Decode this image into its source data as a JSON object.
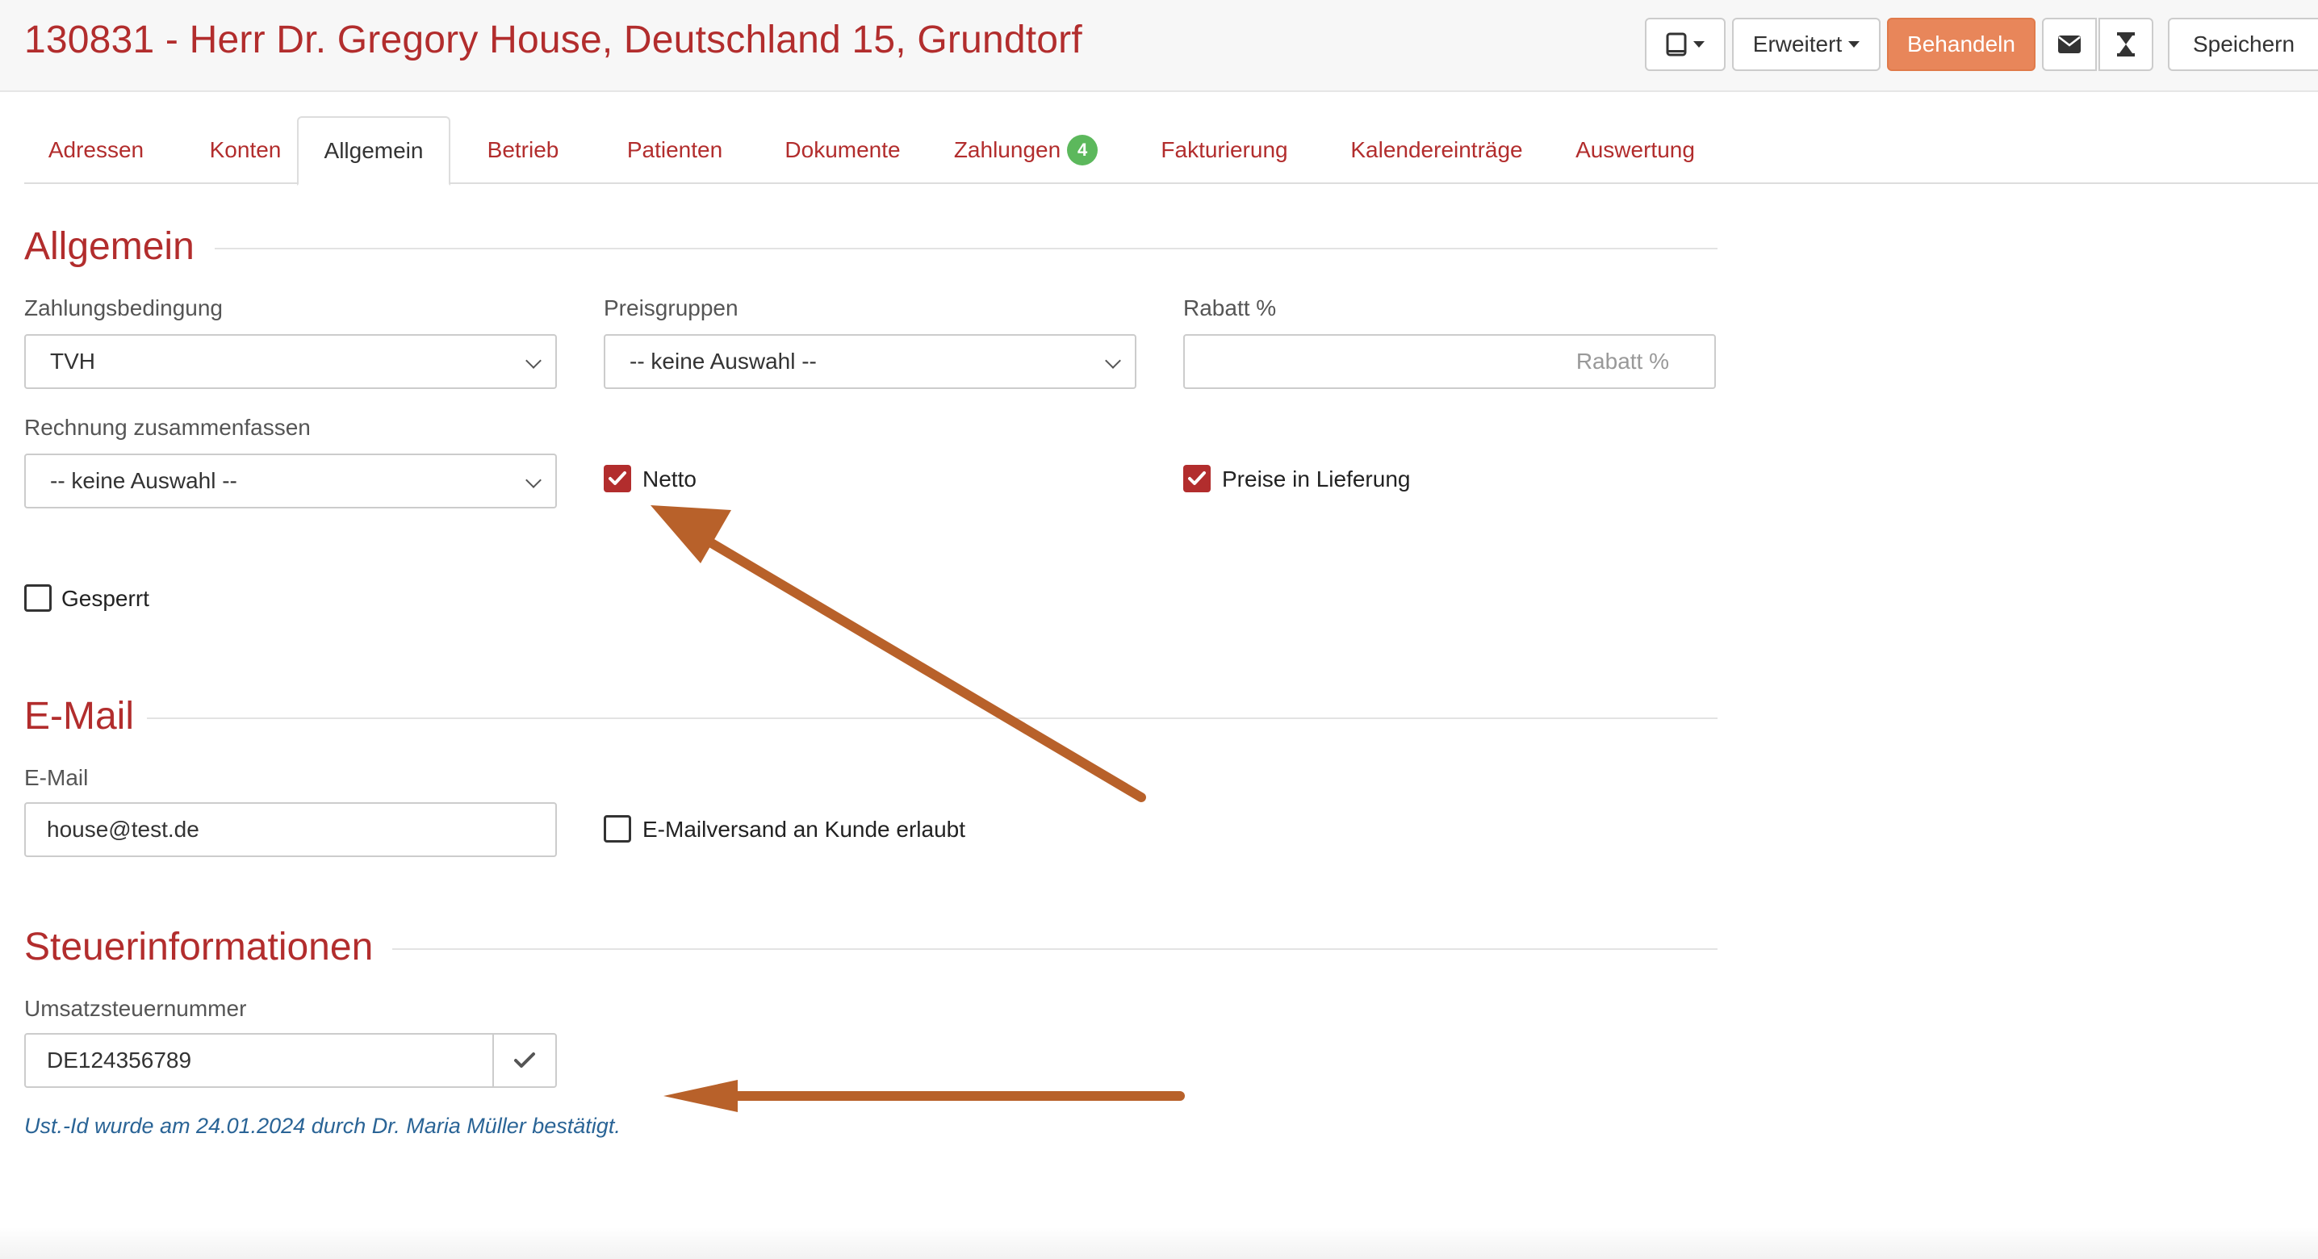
{
  "header": {
    "title": "130831 - Herr Dr. Gregory House, Deutschland 15, Grundtorf",
    "toolbar": {
      "device_icon": "tablet-icon",
      "advanced_label": "Erweitert",
      "treat_label": "Behandeln",
      "mail_icon": "envelope-icon",
      "timer_icon": "hourglass-icon",
      "save_label": "Speichern"
    }
  },
  "tabs": {
    "items": [
      {
        "label": "Adressen"
      },
      {
        "label": "Konten"
      },
      {
        "label": "Allgemein",
        "active": true
      },
      {
        "label": "Betrieb"
      },
      {
        "label": "Patienten"
      },
      {
        "label": "Dokumente"
      },
      {
        "label": "Zahlungen",
        "badge": "4"
      },
      {
        "label": "Fakturierung"
      },
      {
        "label": "Kalendereinträge"
      },
      {
        "label": "Auswertung"
      }
    ]
  },
  "allgemein": {
    "title": "Allgemein",
    "zahlungsbedingung": {
      "label": "Zahlungsbedingung",
      "value": "TVH"
    },
    "preisgruppen": {
      "label": "Preisgruppen",
      "value": "-- keine Auswahl --"
    },
    "rabatt": {
      "label": "Rabatt %",
      "placeholder": "Rabatt %",
      "value": ""
    },
    "rechnung": {
      "label": "Rechnung zusammenfassen",
      "value": "-- keine Auswahl --"
    },
    "netto": {
      "label": "Netto",
      "checked": true
    },
    "preise_in_lieferung": {
      "label": "Preise in Lieferung",
      "checked": true
    },
    "gesperrt": {
      "label": "Gesperrt",
      "checked": false
    }
  },
  "email": {
    "title": "E-Mail",
    "field": {
      "label": "E-Mail",
      "value": "house@test.de"
    },
    "versand": {
      "label": "E-Mailversand an Kunde erlaubt",
      "checked": false
    }
  },
  "steuer": {
    "title": "Steuerinformationen",
    "ust": {
      "label": "Umsatzsteuernummer",
      "value": "DE124356789",
      "verify_icon": "checkmark-icon"
    },
    "note": "Ust.-Id wurde am 24.01.2024 durch Dr. Maria Müller bestätigt."
  },
  "annotations": {
    "color": "#b8612a"
  },
  "colors": {
    "brand": "#b22d2d",
    "primary_button": "#e8865a",
    "badge": "#5cb85c",
    "note": "#2a6496"
  }
}
